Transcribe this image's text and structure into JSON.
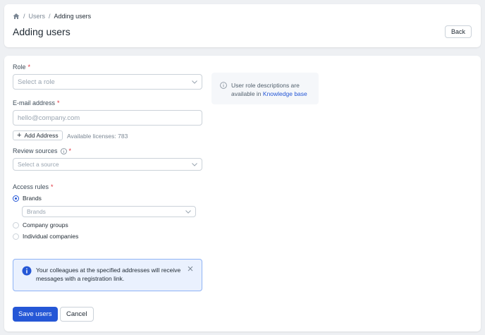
{
  "breadcrumb": {
    "home_icon": "home-icon",
    "separator": "/",
    "users": "Users",
    "current": "Adding users"
  },
  "header": {
    "title": "Adding users",
    "back_label": "Back"
  },
  "form": {
    "role": {
      "label": "Role",
      "required_mark": "*",
      "placeholder": "Select a role"
    },
    "email": {
      "label": "E-mail address",
      "required_mark": "*",
      "placeholder": "hello@company.com",
      "value": ""
    },
    "add_address_label": "Add Address",
    "licenses_text": "Available licenses: 783",
    "review_sources": {
      "label": "Review sources",
      "required_mark": "*",
      "placeholder": "Select a source"
    },
    "access_rules": {
      "label": "Access rules",
      "required_mark": "*",
      "options": [
        {
          "label": "Brands",
          "checked": true
        },
        {
          "label": "Company groups",
          "checked": false
        },
        {
          "label": "Individual companies",
          "checked": false
        }
      ],
      "brands_placeholder": "Brands"
    }
  },
  "role_info": {
    "text": "User role descriptions are available in",
    "link": "Knowledge base"
  },
  "alert": {
    "text": "Your colleagues at the specified addresses will receive messages with a registration link."
  },
  "actions": {
    "save_label": "Save users",
    "cancel_label": "Cancel"
  },
  "colors": {
    "accent": "#2557d6",
    "required": "#e12d39",
    "alert_bg": "#eaf1fe",
    "alert_border": "#8fb3f5"
  }
}
